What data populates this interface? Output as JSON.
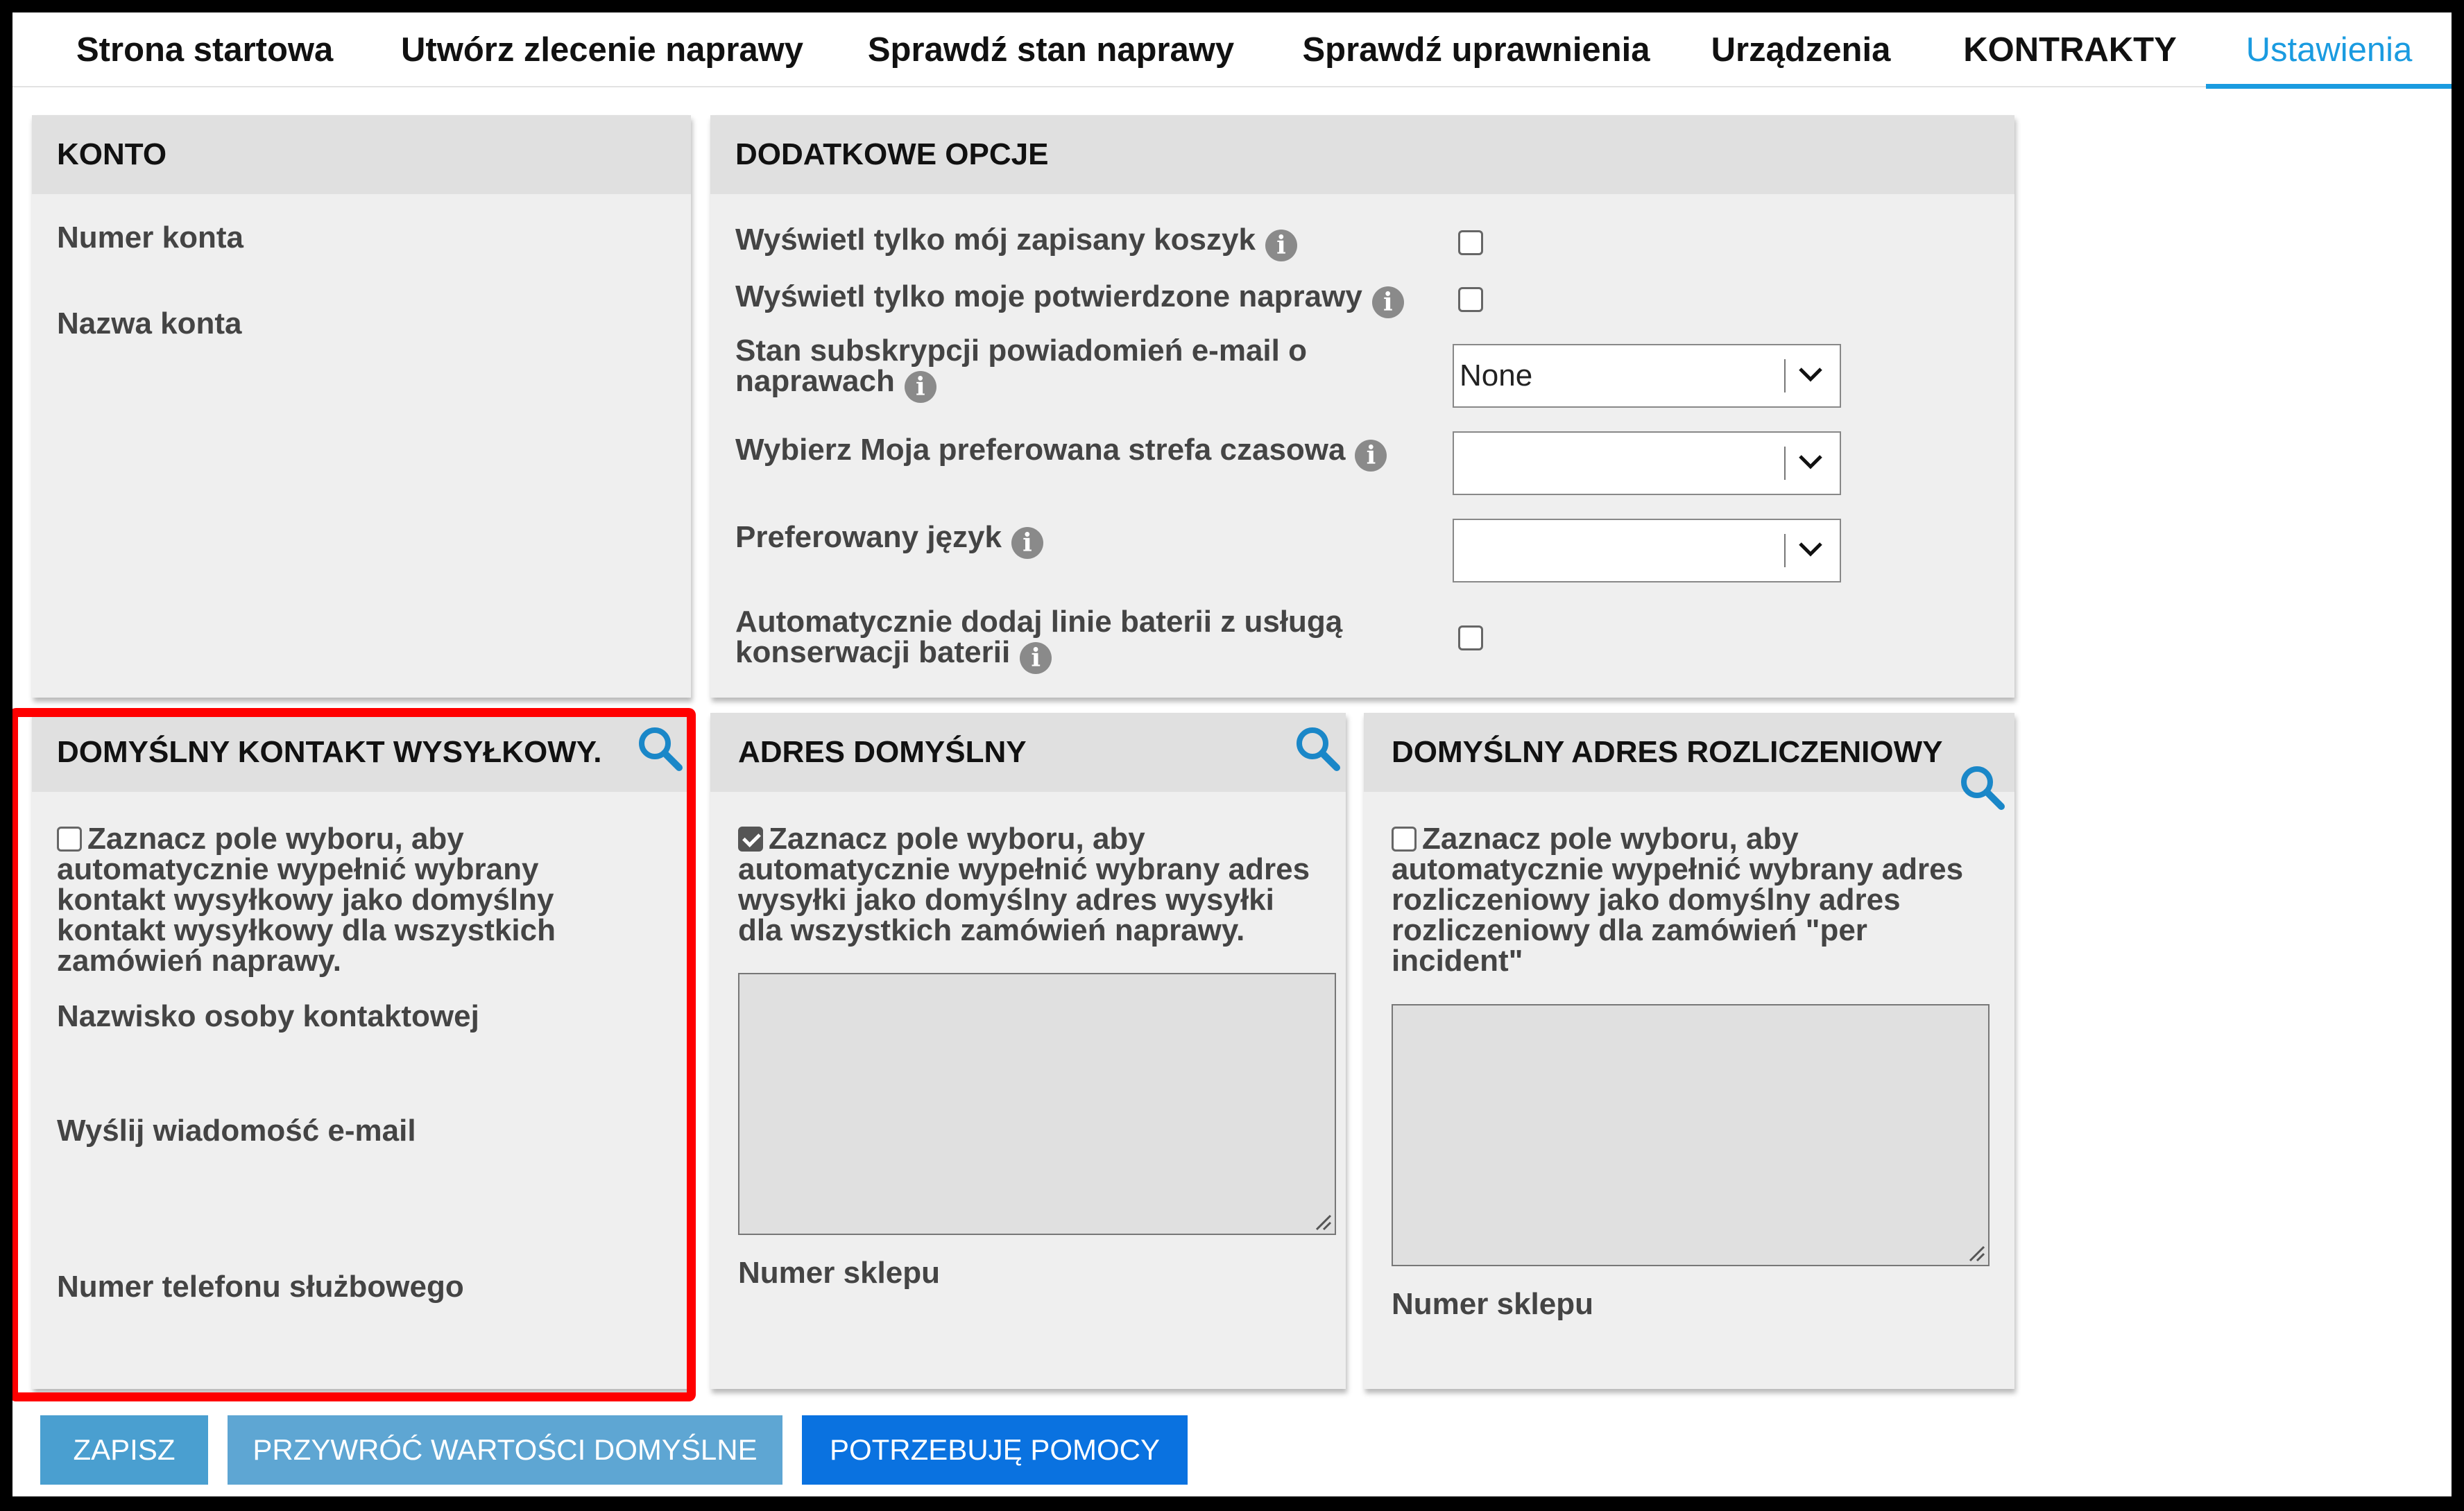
{
  "nav": {
    "tabs": [
      {
        "label": "Strona startowa"
      },
      {
        "label": "Utwórz zlecenie naprawy"
      },
      {
        "label": "Sprawdź stan naprawy"
      },
      {
        "label": "Sprawdź uprawnienia"
      },
      {
        "label": "Urządzenia"
      },
      {
        "label": "KONTRAKTY"
      },
      {
        "label": "Ustawienia",
        "active": true
      }
    ]
  },
  "account": {
    "title": "KONTO",
    "account_number_label": "Numer konta",
    "account_name_label": "Nazwa konta"
  },
  "options": {
    "title": "DODATKOWE OPCJE",
    "saved_cart_label": "Wyświetl tylko mój zapisany koszyk",
    "saved_cart_checked": false,
    "confirmed_repairs_label": "Wyświetl tylko moje potwierdzone naprawy",
    "confirmed_repairs_checked": false,
    "email_subscription_label_line1": "Stan subskrypcji powiadomień e-mail o",
    "email_subscription_label_line2": "naprawach",
    "email_subscription_value": "None",
    "timezone_label": "Wybierz Moja preferowana strefa czasowa",
    "timezone_value": "",
    "language_label": "Preferowany język",
    "language_value": "",
    "battery_label_line1": "Automatycznie dodaj linie baterii z usługą",
    "battery_label_line2": "konserwacji baterii",
    "battery_checked": false,
    "info_glyph": "i"
  },
  "shipping_contact": {
    "title": "DOMYŚLNY KONTAKT WYSYŁKOWY.",
    "checkbox_checked": false,
    "checkbox_text_lines": [
      "Zaznacz pole wyboru, aby",
      "automatycznie wypełnić wybrany",
      "kontakt wysyłkowy jako domyślny",
      "kontakt wysyłkowy dla wszystkich",
      "zamówień naprawy."
    ],
    "contact_name_label": "Nazwisko osoby kontaktowej",
    "email_label": "Wyślij wiadomość e-mail",
    "phone_label": "Numer telefonu służbowego"
  },
  "default_address": {
    "title": "ADRES DOMYŚLNY",
    "checkbox_checked": true,
    "checkbox_text_lines": [
      "Zaznacz pole wyboru, aby",
      "automatycznie wypełnić wybrany adres",
      "wysyłki jako domyślny adres wysyłki",
      "dla wszystkich zamówień naprawy."
    ],
    "store_number_label": "Numer sklepu"
  },
  "billing_address": {
    "title": "DOMYŚLNY ADRES ROZLICZENIOWY",
    "checkbox_checked": false,
    "checkbox_text_lines": [
      "Zaznacz pole wyboru, aby",
      "automatycznie wypełnić wybrany adres",
      "rozliczeniowy jako domyślny adres",
      "rozliczeniowy dla zamówień \"per",
      "incident\""
    ],
    "store_number_label": "Numer sklepu"
  },
  "buttons": {
    "save": "ZAPISZ",
    "restore_defaults": "PRZYWRÓĆ WARTOŚCI DOMYŚLNE",
    "need_help": "POTRZEBUJĘ POMOCY"
  },
  "colors": {
    "accent": "#1a9be0",
    "highlight": "#ff0000",
    "save_button": "#4a9fd0",
    "restore_button": "#5ea6d3",
    "help_button": "#0a72e0",
    "panel_bg": "#efefef",
    "panel_header_bg": "#e0e0e0"
  }
}
